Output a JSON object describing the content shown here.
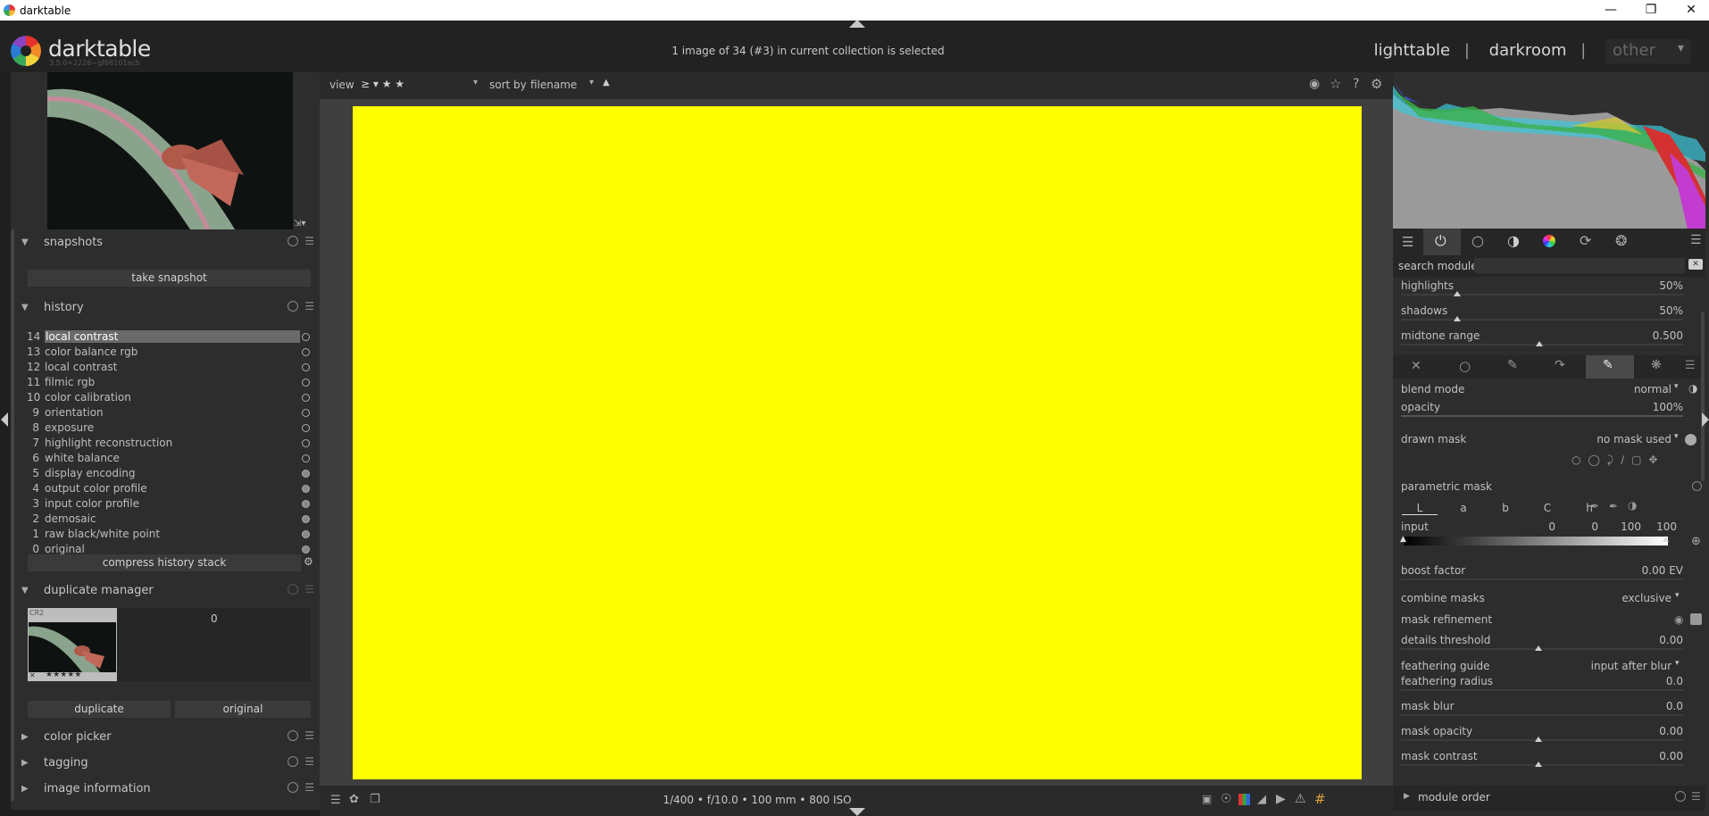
{
  "window": {
    "title": "darktable"
  },
  "header": {
    "logo_text": "darktable",
    "version": "3.5.0+2226~gf68101acb",
    "selection_info": "1 image of 34 (#3) in current collection is selected",
    "views": [
      "lighttable",
      "darkroom",
      "other"
    ],
    "separators": [
      "|",
      "|"
    ]
  },
  "toolbar": {
    "view_label": "view",
    "rating_filter": "≥ ▾ ★ ★",
    "sort_label": "sort by",
    "sort_value": "filename"
  },
  "left": {
    "snapshots": {
      "title": "snapshots",
      "button": "take snapshot"
    },
    "history": {
      "title": "history",
      "items": [
        {
          "n": "14",
          "label": "local contrast"
        },
        {
          "n": "13",
          "label": "color balance rgb"
        },
        {
          "n": "12",
          "label": "local contrast"
        },
        {
          "n": "11",
          "label": "filmic rgb"
        },
        {
          "n": "10",
          "label": "color calibration"
        },
        {
          "n": "9",
          "label": "orientation"
        },
        {
          "n": "8",
          "label": "exposure"
        },
        {
          "n": "7",
          "label": "highlight reconstruction"
        },
        {
          "n": "6",
          "label": "white balance"
        },
        {
          "n": "5",
          "label": "display encoding"
        },
        {
          "n": "4",
          "label": "output color profile"
        },
        {
          "n": "3",
          "label": "input color profile"
        },
        {
          "n": "2",
          "label": "demosaic"
        },
        {
          "n": "1",
          "label": "raw black/white point"
        },
        {
          "n": "0",
          "label": "original"
        }
      ],
      "compress_button": "compress history stack"
    },
    "duplicate_manager": {
      "title": "duplicate manager",
      "thumb_label": "CR2",
      "stars": "★★★★★",
      "count": "0",
      "duplicate_button": "duplicate",
      "original_button": "original"
    },
    "color_picker": {
      "title": "color picker"
    },
    "tagging": {
      "title": "tagging"
    },
    "image_information": {
      "title": "image information"
    }
  },
  "bottom": {
    "exif": "1/400 • f/10.0 • 100 mm • 800 ISO"
  },
  "right": {
    "search_label": "search module",
    "search_value": "",
    "sliders_top": [
      {
        "label": "highlights",
        "value": "50%",
        "pos": 0.2
      },
      {
        "label": "shadows",
        "value": "50%",
        "pos": 0.2
      },
      {
        "label": "midtone range",
        "value": "0.500",
        "pos": 0.49
      }
    ],
    "blend_mode_label": "blend mode",
    "blend_mode_value": "normal",
    "opacity_label": "opacity",
    "opacity_value": "100%",
    "drawn_mask_label": "drawn mask",
    "drawn_mask_value": "no mask used",
    "parametric_mask_label": "parametric mask",
    "channels": [
      "L",
      "a",
      "b",
      "C",
      "h"
    ],
    "input_label": "input",
    "input_values": [
      "0",
      "0",
      "100",
      "100"
    ],
    "boost_factor_label": "boost factor",
    "boost_factor_value": "0.00 EV",
    "combine_masks_label": "combine masks",
    "combine_masks_value": "exclusive",
    "mask_refinement_label": "mask refinement",
    "details_threshold_label": "details threshold",
    "details_threshold_value": "0.00",
    "feathering_guide_label": "feathering guide",
    "feathering_guide_value": "input after blur",
    "feathering_radius_label": "feathering radius",
    "feathering_radius_value": "0.0",
    "mask_blur_label": "mask blur",
    "mask_blur_value": "0.0",
    "mask_opacity_label": "mask opacity",
    "mask_opacity_value": "0.00",
    "mask_contrast_label": "mask contrast",
    "mask_contrast_value": "0.00",
    "module_order_label": "module order"
  },
  "colors": {
    "image_fill": "#ffff00",
    "panel": "#2d2d2d",
    "selected_row": "#6a6a6a"
  }
}
